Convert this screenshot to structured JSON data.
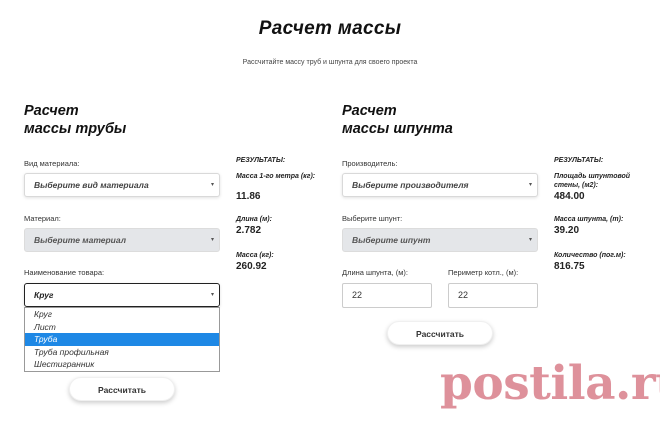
{
  "header": {
    "title": "Расчет массы",
    "subtitle": "Рассчитайте массу труб и шпунта для своего проекта"
  },
  "pipe": {
    "title_line1": "Расчет",
    "title_line2": "массы трубы",
    "material_type_label": "Вид материала:",
    "material_type_value": "Выберите вид материала",
    "material_label": "Материал:",
    "material_value": "Выберите материал",
    "product_label": "Наименование товара:",
    "product_value": "Круг",
    "product_options": [
      "Круг",
      "Лист",
      "Труба",
      "Труба профильная",
      "Шестигранник"
    ],
    "product_options_selected": "Труба",
    "calc_button": "Рассчитать",
    "results": {
      "heading": "РЕЗУЛЬТАТЫ:",
      "mass_per_meter_label": "Масса 1-го метра (кг):",
      "mass_per_meter_value": "11.86",
      "length_label": "Длина (м):",
      "length_value": "2.782",
      "mass_label": "Масса (кг):",
      "mass_value": "260.92"
    }
  },
  "sheet_pile": {
    "title_line1": "Расчет",
    "title_line2": "массы шпунта",
    "manufacturer_label": "Производитель:",
    "manufacturer_value": "Выберите производителя",
    "pile_label": "Выберите шпунт:",
    "pile_value": "Выберите шпунт",
    "length_label": "Длина шпунта, (м):",
    "length_value": "22",
    "perimeter_label": "Периметр котл., (м):",
    "perimeter_value": "22",
    "calc_button": "Рассчитать",
    "results": {
      "heading": "РЕЗУЛЬТАТЫ:",
      "area_label": "Площадь шпунтовой стены, (м2):",
      "area_value": "484.00",
      "mass_label": "Масса шпунта, (т):",
      "mass_value": "39.20",
      "count_label": "Количество (пог.м):",
      "count_value": "816.75"
    }
  },
  "watermark": "postila.ru",
  "icons": {
    "dropdown_arrow": "▾"
  },
  "colors": {
    "highlight": "#1e88e5",
    "watermark": "#c4394a"
  }
}
